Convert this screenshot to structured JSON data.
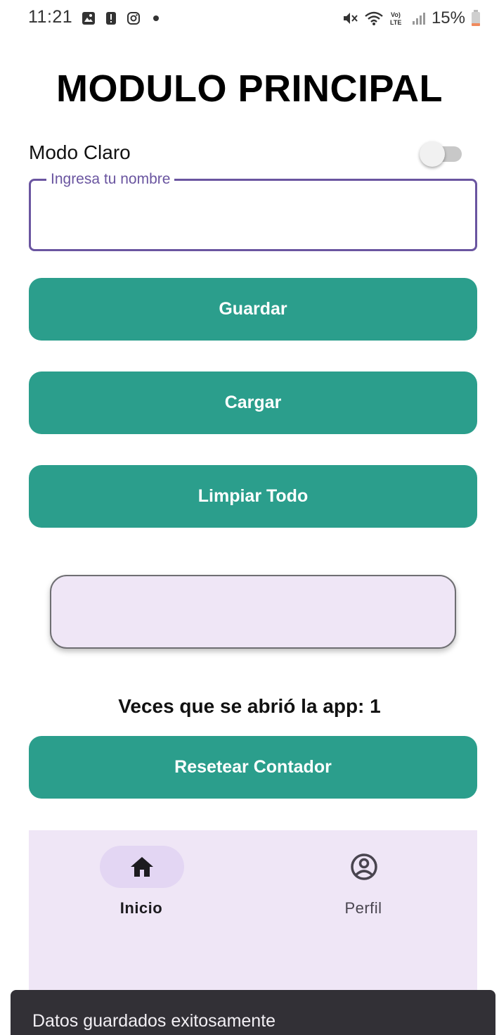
{
  "status_bar": {
    "time": "11:21",
    "battery": "15%",
    "left_icons": [
      "gallery-icon",
      "alert-icon",
      "instagram-icon",
      "dot-icon"
    ],
    "right_icons": [
      "mute-icon",
      "wifi-icon",
      "volte-icon",
      "signal-icon",
      "battery-icon"
    ]
  },
  "title": "MODULO PRINCIPAL",
  "theme_toggle": {
    "label": "Modo Claro",
    "checked": false
  },
  "name_field": {
    "label": "Ingresa tu nombre",
    "value": ""
  },
  "buttons": {
    "save": "Guardar",
    "load": "Cargar",
    "clear": "Limpiar Todo",
    "reset": "Resetear Contador"
  },
  "result_card": {
    "text": ""
  },
  "counter": {
    "text": "Veces que se abrió la app: 1"
  },
  "bottom_nav": {
    "items": [
      {
        "label": "Inicio",
        "icon": "home-icon",
        "active": true
      },
      {
        "label": "Perfil",
        "icon": "account-circle-icon",
        "active": false
      }
    ]
  },
  "snackbar": {
    "message": "Datos guardados exitosamente"
  },
  "colors": {
    "primary_button": "#2b9e8c",
    "field_outline": "#6a55a0",
    "surface_container": "#efe6f6",
    "snackbar_bg": "#323036"
  }
}
